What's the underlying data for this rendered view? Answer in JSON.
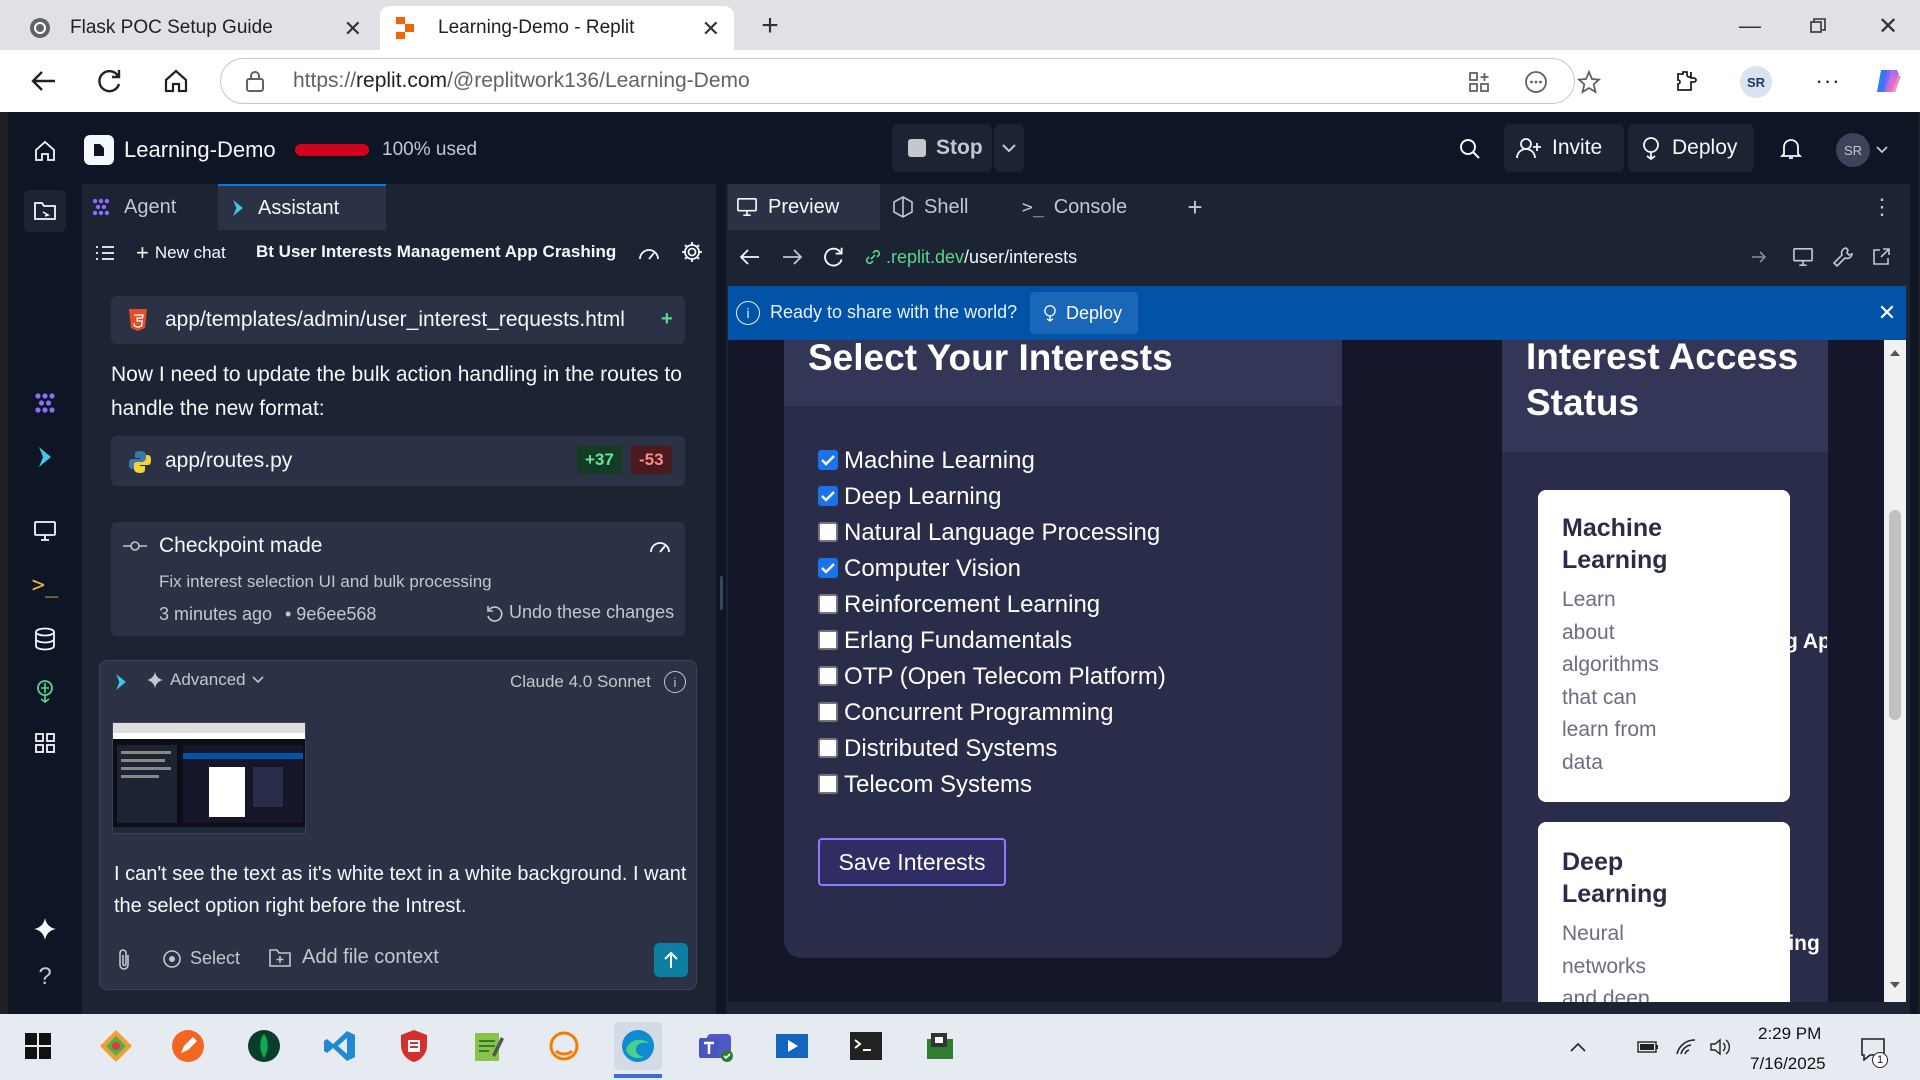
{
  "browser": {
    "tabs": [
      {
        "title": "Flask POC Setup Guide"
      },
      {
        "title": "Learning-Demo - Replit"
      }
    ],
    "url_prefix": "https://",
    "url_domain": "replit.com",
    "url_path": "/@replitwork136/Learning-Demo",
    "profile_initials": "SR"
  },
  "app": {
    "repl_name": "Learning-Demo",
    "usage_text": "100% used",
    "usage_color": "#d0021b",
    "stop_label": "Stop",
    "invite_label": "Invite",
    "deploy_label": "Deploy",
    "user_initials": "SR"
  },
  "chat": {
    "tabs": [
      {
        "label": "Agent"
      },
      {
        "label": "Assistant"
      }
    ],
    "new_chat_label": "New chat",
    "chat_title": "Bt User Interests Management App Crashing",
    "file_item_1": "app/templates/admin/user_interest_requests.html",
    "file_item_1_badge": "+",
    "message_1": "Now I need to update the bulk action handling in the routes to handle the new format:",
    "file_item_2": "app/routes.py",
    "additions": "+37",
    "deletions": "-53",
    "checkpoint": {
      "title": "Checkpoint made",
      "description": "Fix interest selection UI and bulk processing",
      "time": "3 minutes ago",
      "commit": "• 9e6ee568",
      "undo_label": "Undo these changes"
    },
    "input": {
      "mode_label": "Advanced",
      "model_label": "Claude 4.0 Sonnet",
      "message_text": "I can't see the text as it's white text in a white background. I want the select option right before the Intrest.",
      "select_label": "Select",
      "add_context_label": "Add file context"
    }
  },
  "preview": {
    "tabs": [
      {
        "label": "Preview"
      },
      {
        "label": "Shell"
      },
      {
        "label": "Console"
      }
    ],
    "url_domain": ".replit.dev",
    "url_path": "/user/interests",
    "banner_text": "Ready to share with the world?",
    "banner_deploy": "Deploy",
    "colors": {
      "banner": "#0053a6",
      "checkbox_on": "#1a73e8",
      "url_green": "#58d68d"
    }
  },
  "site": {
    "select_title": "Select Your Interests",
    "interests": [
      {
        "label": "Machine Learning",
        "checked": true
      },
      {
        "label": "Deep Learning",
        "checked": true
      },
      {
        "label": "Natural Language Processing",
        "checked": false
      },
      {
        "label": "Computer Vision",
        "checked": true
      },
      {
        "label": "Reinforcement Learning",
        "checked": false
      },
      {
        "label": "Erlang Fundamentals",
        "checked": false
      },
      {
        "label": "OTP (Open Telecom Platform)",
        "checked": false
      },
      {
        "label": "Concurrent Programming",
        "checked": false
      },
      {
        "label": "Distributed Systems",
        "checked": false
      },
      {
        "label": "Telecom Systems",
        "checked": false
      }
    ],
    "save_label": "Save Interests",
    "status_title": "Interest Access Status",
    "cards": [
      {
        "title": "Machine Learning",
        "desc_lines": [
          "Learn",
          "about",
          "algorithms",
          "that can",
          "learn from",
          "data"
        ],
        "badge": "Pending Ap"
      },
      {
        "title": "Deep Learning",
        "desc_lines": [
          "Neural",
          "networks",
          "and deep"
        ],
        "badge": "Pending"
      }
    ]
  },
  "taskbar": {
    "time": "2:29 PM",
    "date": "7/16/2025",
    "notification_count": "1"
  }
}
